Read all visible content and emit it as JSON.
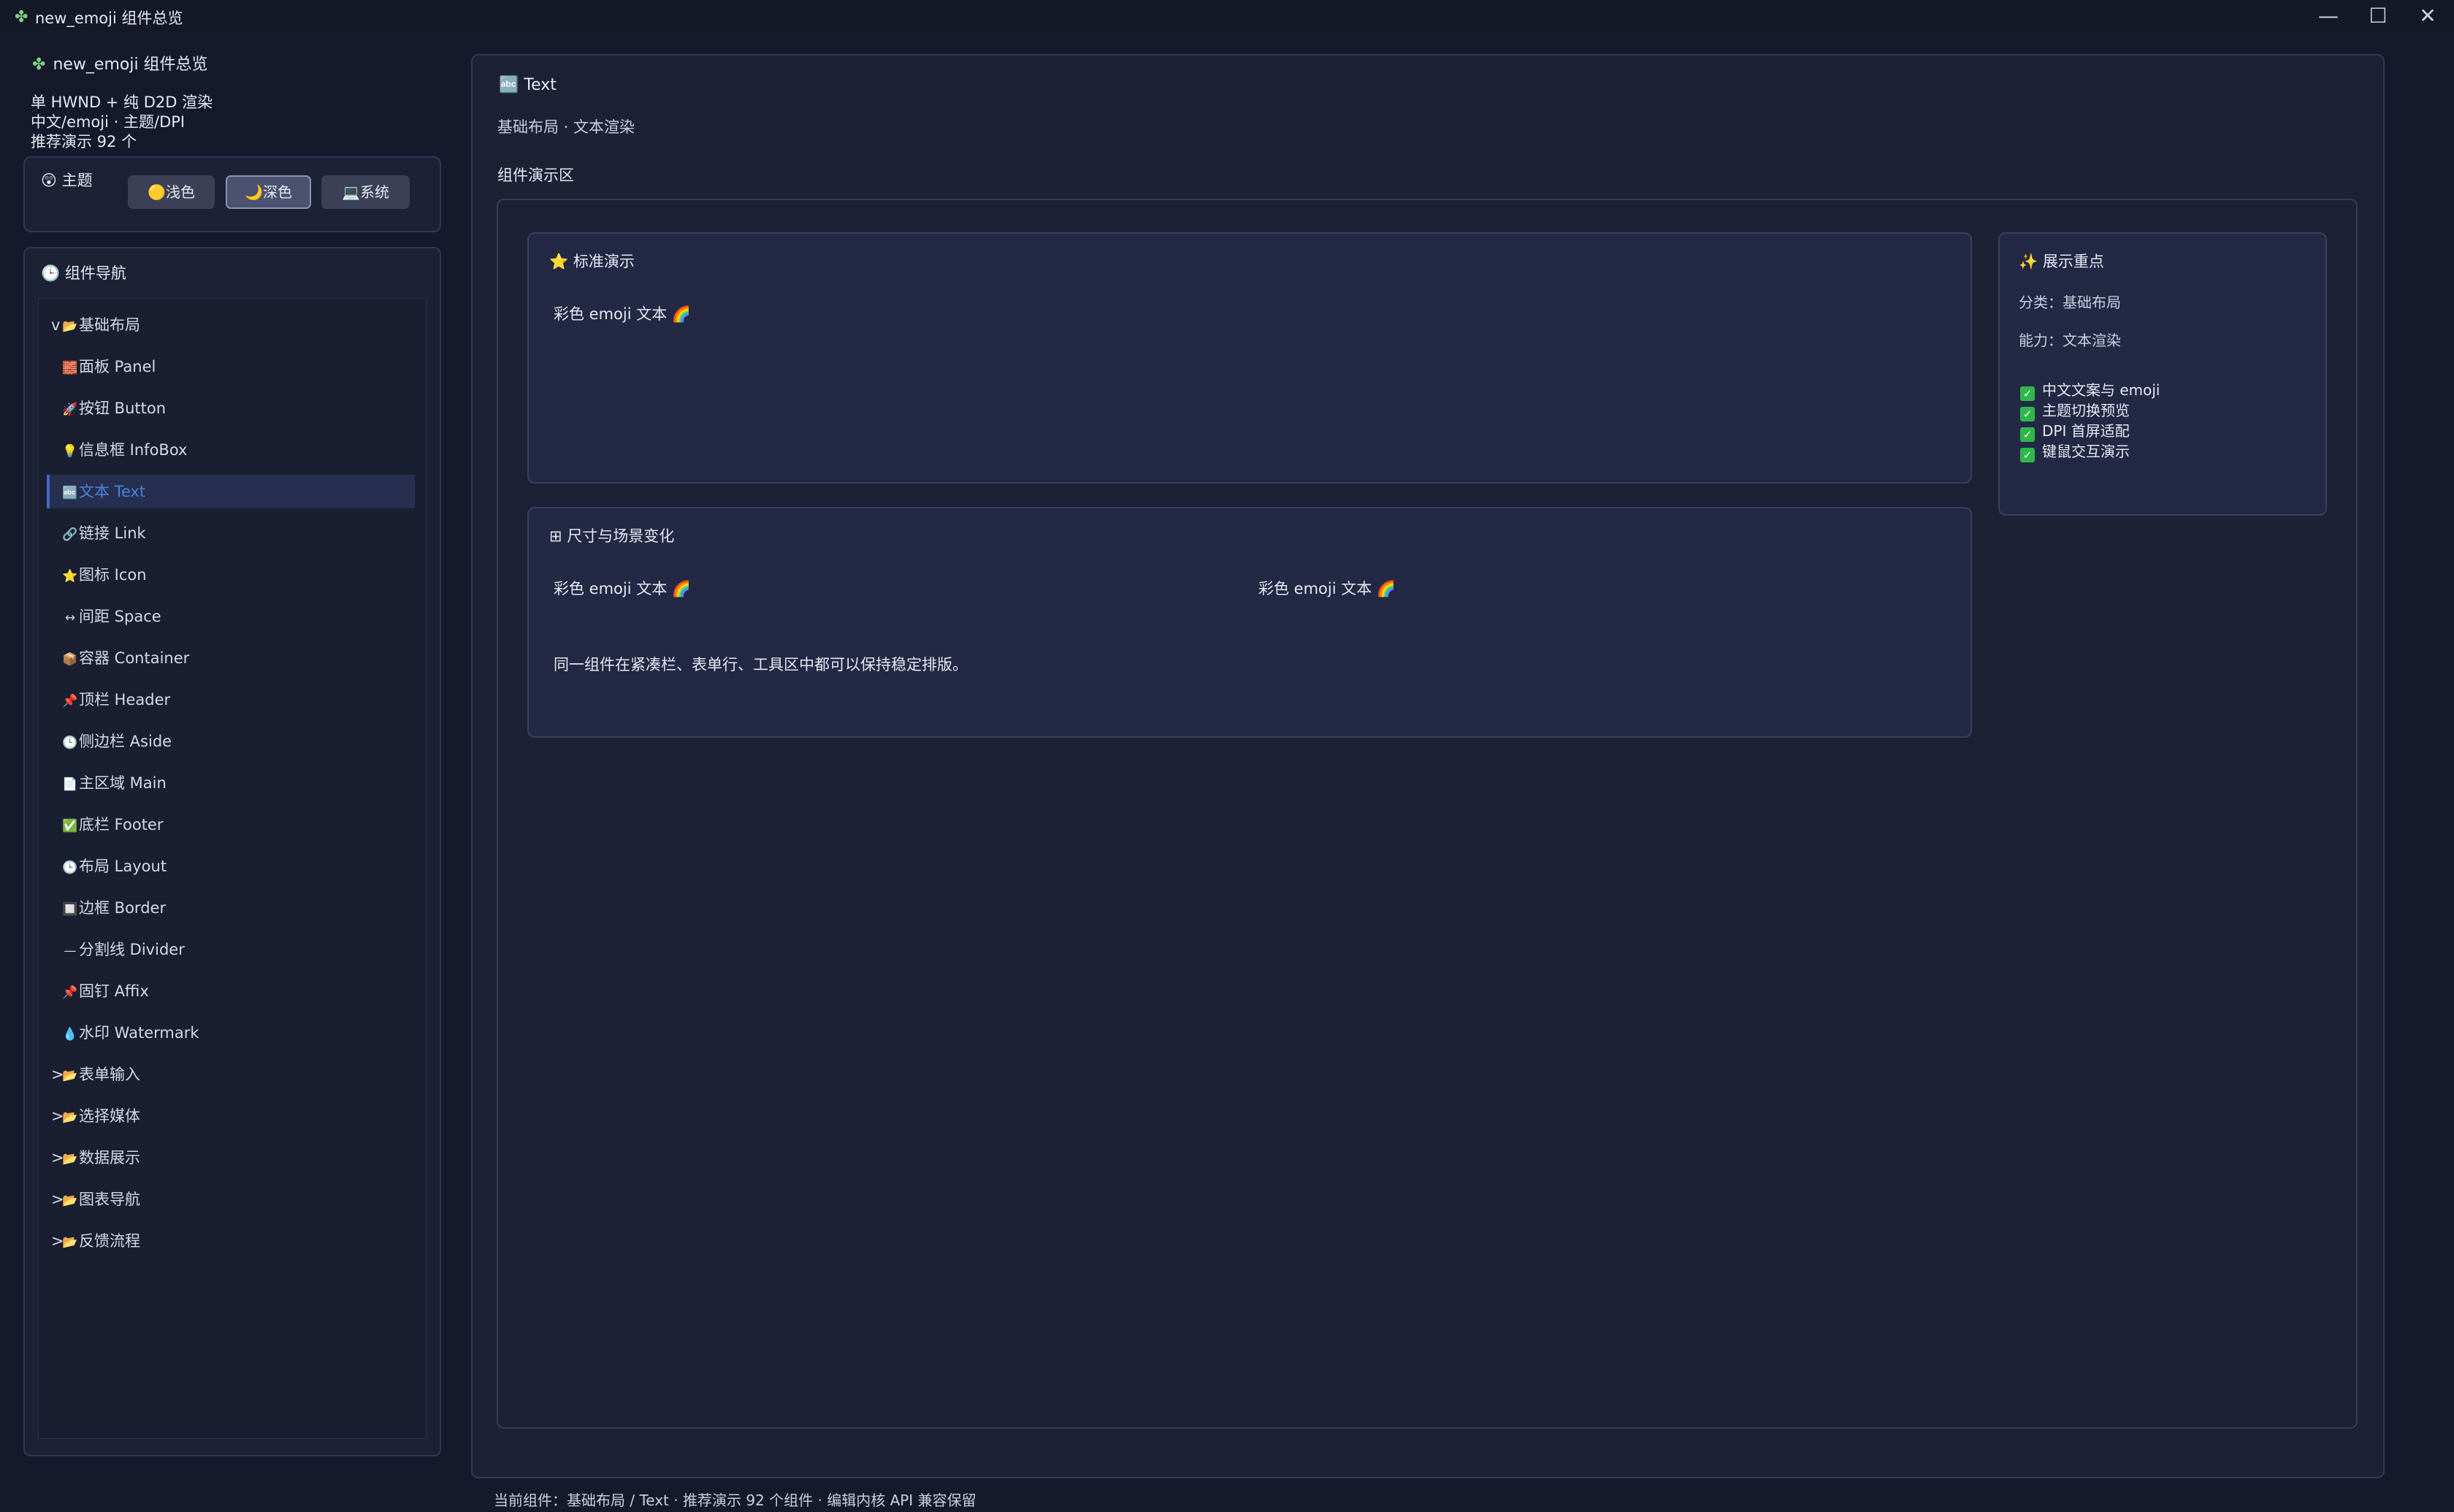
{
  "window": {
    "title": "new_emoji 组件总览",
    "app_icon": "✤",
    "controls": {
      "minimize": "—",
      "maximize": "☐",
      "close": "✕"
    }
  },
  "sidebar": {
    "app_name": "new_emoji 组件总览",
    "info_lines": [
      "单 HWND + 纯 D2D 渲染",
      "中文/emoji · 主题/DPI",
      "推荐演示 92 个"
    ],
    "theme": {
      "icon": "😲",
      "title": "主题",
      "options": [
        {
          "icon": "🟡",
          "label": "浅色"
        },
        {
          "icon": "🌙",
          "label": "深色"
        },
        {
          "icon": "💻",
          "label": "系统"
        }
      ],
      "selected": "深色"
    },
    "nav": {
      "icon": "🕒",
      "title": "组件导航",
      "groups": [
        {
          "caret": "v",
          "icon": "📂",
          "label": "基础布局",
          "items": [
            {
              "icon": "🧱",
              "label": "面板 Panel"
            },
            {
              "icon": "🚀",
              "label": "按钮 Button"
            },
            {
              "icon": "💡",
              "label": "信息框 InfoBox"
            },
            {
              "icon": "🔤",
              "label": "文本 Text"
            },
            {
              "icon": "🔗",
              "label": "链接 Link"
            },
            {
              "icon": "⭐",
              "label": "图标 Icon"
            },
            {
              "icon": "↔",
              "label": "间距 Space"
            },
            {
              "icon": "📦",
              "label": "容器 Container"
            },
            {
              "icon": "📌",
              "label": "顶栏 Header"
            },
            {
              "icon": "🕒",
              "label": "侧边栏 Aside"
            },
            {
              "icon": "📄",
              "label": "主区域 Main"
            },
            {
              "icon": "✅",
              "label": "底栏 Footer"
            },
            {
              "icon": "🕒",
              "label": "布局 Layout"
            },
            {
              "icon": "🔲",
              "label": "边框 Border"
            },
            {
              "icon": "—",
              "label": "分割线 Divider"
            },
            {
              "icon": "📌",
              "label": "固钉 Affix"
            },
            {
              "icon": "💧",
              "label": "水印 Watermark"
            }
          ]
        },
        {
          "caret": ">",
          "icon": "📂",
          "label": "表单输入"
        },
        {
          "caret": ">",
          "icon": "📂",
          "label": "选择媒体"
        },
        {
          "caret": ">",
          "icon": "📂",
          "label": "数据展示"
        },
        {
          "caret": ">",
          "icon": "📂",
          "label": "图表导航"
        },
        {
          "caret": ">",
          "icon": "📂",
          "label": "反馈流程"
        }
      ],
      "active": "文本 Text"
    }
  },
  "main": {
    "title_icon": "🔤",
    "title": "Text",
    "subtitle": "基础布局 · 文本渲染",
    "demo_label": "组件演示区",
    "standard": {
      "icon": "⭐",
      "title": "标准演示",
      "text": "彩色 emoji 文本 🌈"
    },
    "size": {
      "icon": "⊞",
      "title": "尺寸与场景变化",
      "text_a": "彩色 emoji 文本 🌈",
      "text_b": "彩色 emoji 文本 🌈",
      "description": "同一组件在紧凑栏、表单行、工具区中都可以保持稳定排版。"
    },
    "focus": {
      "icon": "✨",
      "title": "展示重点",
      "category": "分类：基础布局",
      "capability": "能力：文本渲染",
      "checks": [
        "中文文案与 emoji",
        "主题切换预览",
        "DPI 首屏适配",
        "键鼠交互演示"
      ]
    }
  },
  "status_bar": "当前组件：基础布局 / Text · 推荐演示 92 个组件 · 编辑内核 API 兼容保留",
  "colors": {
    "background": "#15192b",
    "panel": "#1c2136",
    "card": "#232844",
    "accent": "#4a82d9",
    "check": "#2fb84a"
  }
}
